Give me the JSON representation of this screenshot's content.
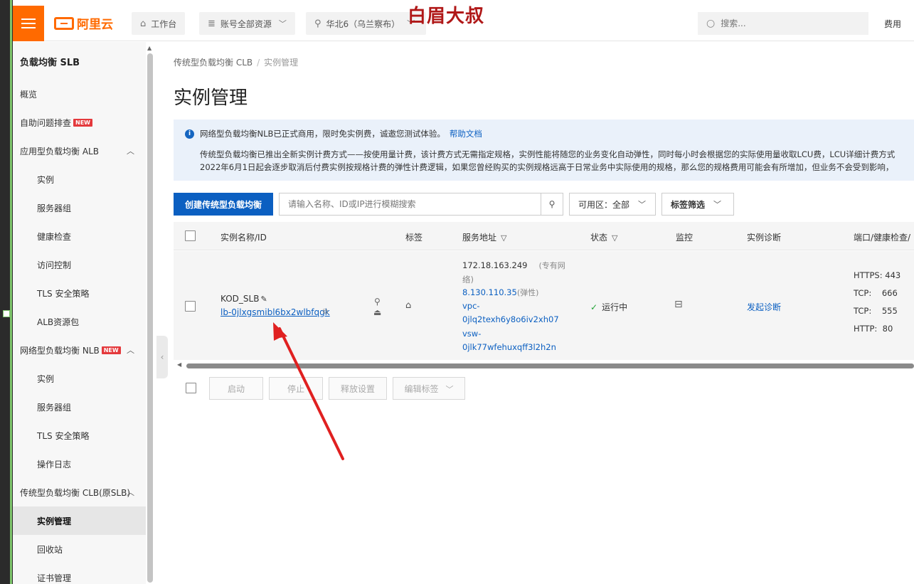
{
  "topbar": {
    "logo_text": "阿里云",
    "workbench": "工作台",
    "resources": "账号全部资源",
    "region": "华北6（乌兰察布）",
    "watermark": "白眉大叔",
    "search_placeholder": "搜索...",
    "fee": "费用"
  },
  "sidebar": {
    "title": "负载均衡 SLB",
    "items": [
      {
        "label": "概览"
      },
      {
        "label": "自助问题排查",
        "badge": "NEW"
      },
      {
        "label": "应用型负载均衡 ALB"
      },
      {
        "label": "实例"
      },
      {
        "label": "服务器组"
      },
      {
        "label": "健康检查"
      },
      {
        "label": "访问控制"
      },
      {
        "label": "TLS 安全策略"
      },
      {
        "label": "ALB资源包"
      },
      {
        "label": "网络型负载均衡 NLB",
        "badge": "NEW"
      },
      {
        "label": "实例"
      },
      {
        "label": "服务器组"
      },
      {
        "label": "TLS 安全策略"
      },
      {
        "label": "操作日志"
      },
      {
        "label": "传统型负载均衡 CLB(原SLB)"
      },
      {
        "label": "实例管理"
      },
      {
        "label": "回收站"
      },
      {
        "label": "证书管理"
      }
    ]
  },
  "main": {
    "breadcrumb": [
      "传统型负载均衡 CLB",
      "实例管理"
    ],
    "title": "实例管理",
    "notice": {
      "headline": "网络型负载均衡NLB已正式商用，限时免实例费，诚邀您测试体验。",
      "link": "帮助文档",
      "line1": "传统型负载均衡已推出全新实例计费方式——按使用量计费，该计费方式无需指定规格，实例性能将随您的业务变化自动弹性，同时每小时会根据您的实际使用量收取LCU费，LCU详细计费方式",
      "line2": "2022年6月1日起会逐步取消后付费实例按规格计费的弹性计费逻辑，如果您曾经购买的实例规格远高于日常业务中实际使用的规格，那么您的规格费用可能会有所增加，但业务不会受到影响，"
    },
    "toolbar": {
      "create": "创建传统型负载均衡",
      "search_placeholder": "请输入名称、ID或IP进行模糊搜索",
      "zone": "可用区：全部",
      "tag_filter": "标签筛选"
    },
    "table": {
      "headers": [
        "实例名称/ID",
        "标签",
        "服务地址",
        "状态",
        "监控",
        "实例诊断",
        "端口/健康检查/"
      ],
      "row": {
        "name": "KOD_SLB",
        "id": "lb-0jlxgsmibl6bx2wlbfqgk",
        "addr_ip": "172.18.163.249",
        "addr_type_a": "(专有网",
        "addr_type_b": "络)",
        "addr_eip": "8.130.110.35",
        "addr_eip_type": "(弹性)",
        "vpc_a": "vpc-",
        "vpc_b": "0jlq2texh6y8o6iv2xh07",
        "vsw_a": "vsw-",
        "vsw_b": "0jlk77wfehuxqff3l2h2n",
        "status": "运行中",
        "diagnose": "发起诊断",
        "ports": [
          {
            "proto": "HTTPS:",
            "port": "443"
          },
          {
            "proto": "TCP:",
            "port": "666"
          },
          {
            "proto": "TCP:",
            "port": "555"
          },
          {
            "proto": "HTTP:",
            "port": "80"
          }
        ]
      }
    },
    "actions": {
      "start": "启动",
      "stop": "停止",
      "release": "释放设置",
      "edit_tags": "编辑标签"
    }
  },
  "colors": {
    "brand": "#ff6a00",
    "primary": "#0b5fc1",
    "status_ok": "#21a336",
    "annotation": "#e02020"
  }
}
